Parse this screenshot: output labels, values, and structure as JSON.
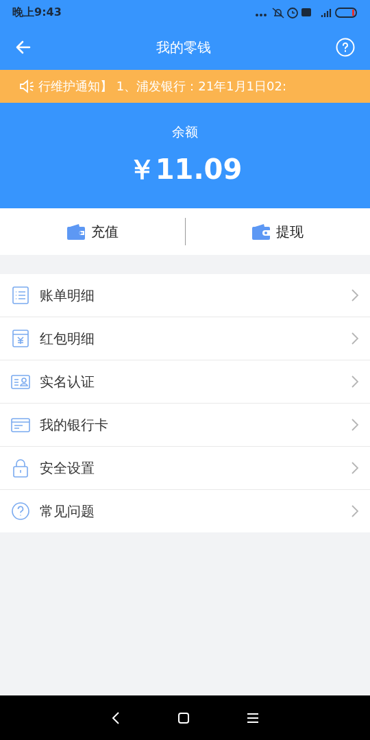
{
  "status_bar": {
    "time": "晚上9:43"
  },
  "nav": {
    "title": "我的零钱"
  },
  "notice": {
    "text": "行维护通知】 1、浦发银行：21年1月1日02:"
  },
  "balance": {
    "label": "余额",
    "amount": "￥11.09"
  },
  "actions": [
    {
      "kind": "recharge",
      "label": "充值"
    },
    {
      "kind": "withdraw",
      "label": "提现"
    }
  ],
  "menu": [
    {
      "kind": "list",
      "label": "账单明细"
    },
    {
      "kind": "redpacket",
      "label": "红包明细"
    },
    {
      "kind": "idcard",
      "label": "实名认证"
    },
    {
      "kind": "card",
      "label": "我的银行卡"
    },
    {
      "kind": "lock",
      "label": "安全设置"
    },
    {
      "kind": "help",
      "label": "常见问题"
    }
  ]
}
